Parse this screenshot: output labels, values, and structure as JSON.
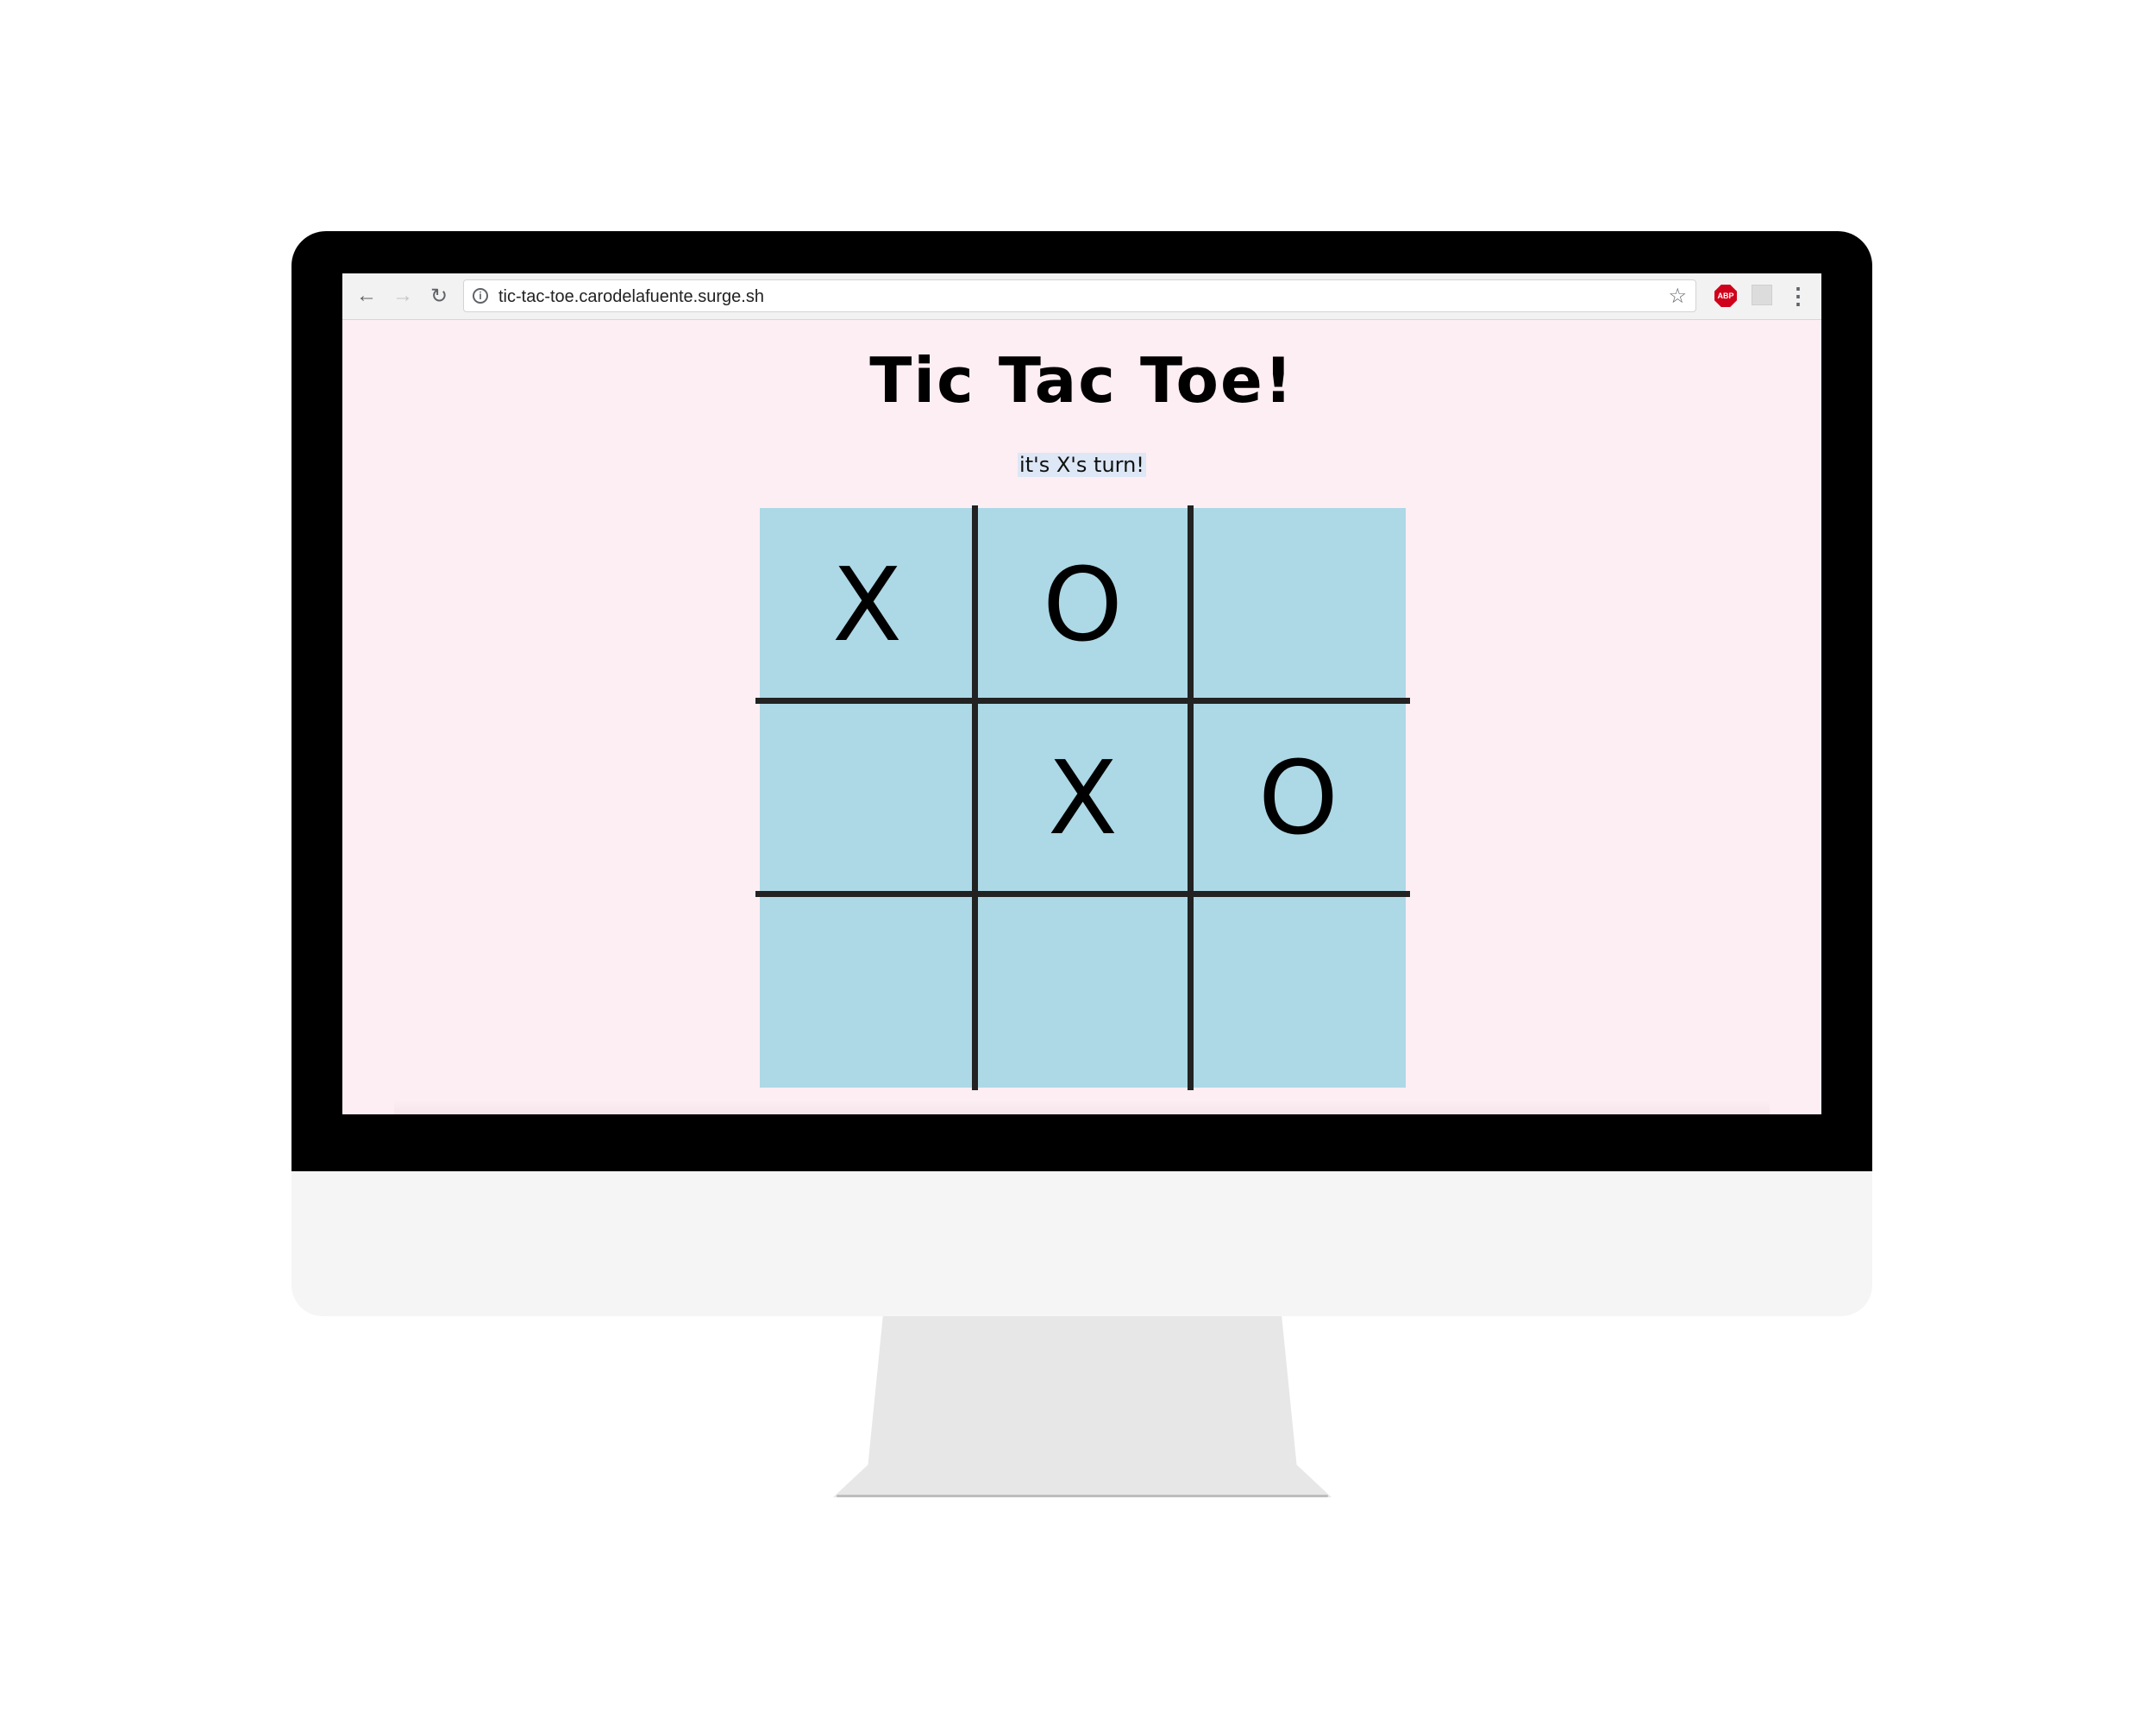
{
  "browser": {
    "url": "tic-tac-toe.carodelafuente.surge.sh",
    "back_icon": "←",
    "forward_icon": "→",
    "reload_icon": "↻",
    "info_icon": "i",
    "star_icon": "☆",
    "abp_label": "ABP",
    "menu_icon": "⋮"
  },
  "page": {
    "title": "Tic Tac Toe!",
    "turn_status": "it's X's turn!"
  },
  "board": {
    "cells": [
      [
        "X",
        "O",
        ""
      ],
      [
        "",
        "X",
        "O"
      ],
      [
        "",
        "",
        ""
      ]
    ]
  },
  "colors": {
    "page_background": "#fdeef3",
    "board_background": "#add8e6",
    "grid_lines": "#222222",
    "turn_highlight": "#dde7f5"
  }
}
